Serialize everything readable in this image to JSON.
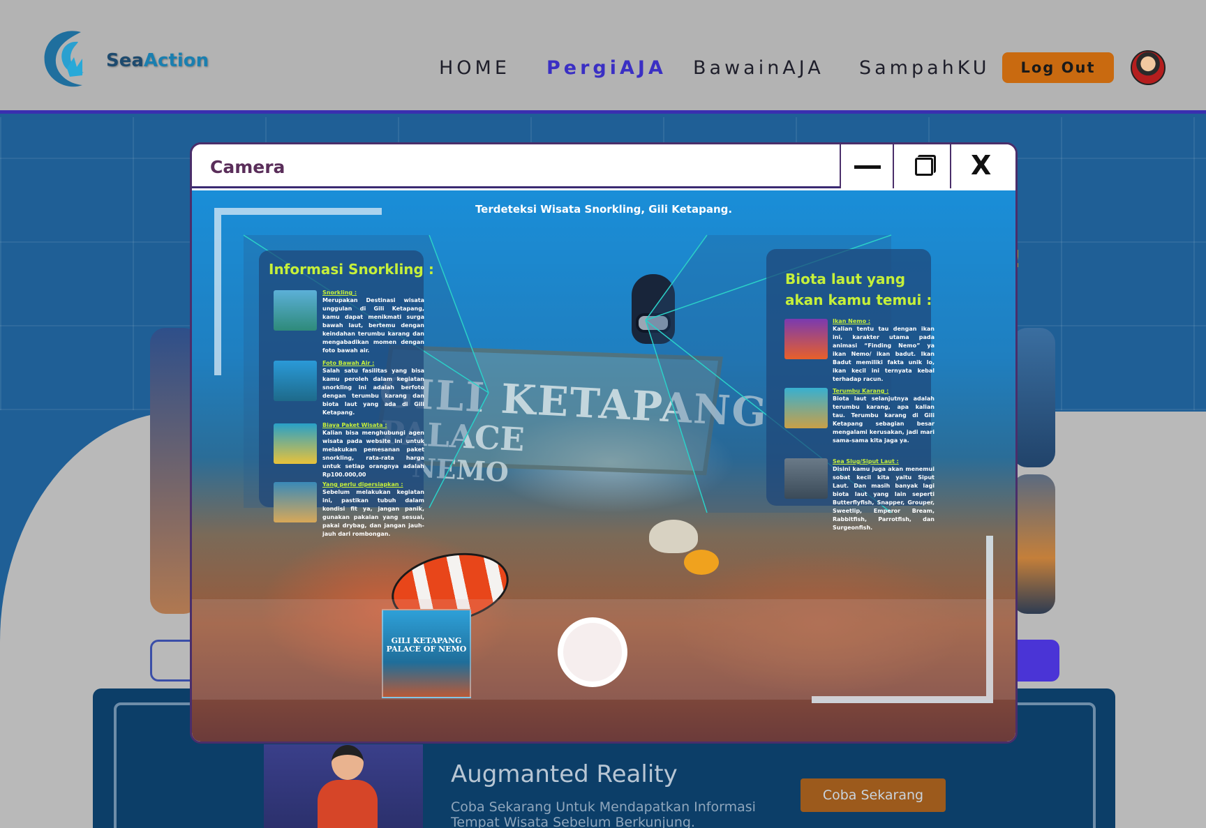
{
  "nav": {
    "brand": {
      "part1": "Sea",
      "part2": "Action"
    },
    "links": [
      "HOME",
      "PergiAJA",
      "BawainAJA",
      "SampahKU"
    ],
    "active": "PergiAJA",
    "logout_label": "Log Out",
    "accent_color": "#3a2fc4",
    "logout_color": "#c96a10"
  },
  "background": {
    "exclaim": "!",
    "ar_section": {
      "title": "Augmanted Reality",
      "description": "Coba Sekarang Untuk Mendapatkan Informasi Tempat Wisata Sebelum Berkunjung.",
      "cta": "Coba Sekarang"
    }
  },
  "camera": {
    "title": "Camera",
    "close_glyph": "X",
    "detection": "Terdeteksi Wisata Snorkling, Gili Ketapang.",
    "sign_text": [
      "GILI KETAPANG",
      "PALACE",
      "NEMO"
    ],
    "thumbnail_text": "GILI KETAPANG PALACE OF NEMO",
    "left_panel": {
      "title": "Informasi Snorkling :",
      "items": [
        {
          "heading": "Snorkling :",
          "text": "Merupakan Destinasi wisata unggulan di Gili Ketapang, kamu dapat menikmati surga bawah laut, bertemu dengan keindahan terumbu karang dan mengabadikan momen dengan foto bawah air."
        },
        {
          "heading": "Foto Bawah Air :",
          "text": "Salah satu fasilitas yang bisa kamu peroleh dalam kegiatan snorkling ini adalah berfoto dengan terumbu karang dan biota laut yang ada di Gili Ketapang."
        },
        {
          "heading": "Biaya Paket Wisata :",
          "text": "Kalian bisa menghubungi agen wisata pada website ini untuk melakukan pemesanan paket snorkling, rata-rata harga untuk setiap orangnya adalah Rp100.000,00"
        },
        {
          "heading": "Yang perlu dipersiapkan :",
          "text": "Sebelum melakukan kegiatan ini, pastikan tubuh dalam kondisi fit ya, jangan panik, gunakan pakaian yang sesuai, pakai drybag, dan jangan jauh-jauh dari rombongan."
        }
      ]
    },
    "right_panel": {
      "title": "Biota laut yang akan kamu temui :",
      "items": [
        {
          "heading": "Ikan Nemo :",
          "text": "Kalian tentu tau dengan ikan ini, karakter utama pada animasi “Finding Nemo” ya ikan Nemo/ ikan badut. Ikan Badut memiliki fakta unik lo, ikan kecil ini ternyata kebal terhadap racun."
        },
        {
          "heading": "Terumbu Karang :",
          "text": "Biota laut selanjutnya adalah terumbu karang, apa kalian tau. Terumbu karang di Gili Ketapang sebagian besar mengalami kerusakan, jadi mari sama-sama kita jaga ya."
        },
        {
          "heading": "Sea Slug/Siput Laut :",
          "text": "Disini kamu juga akan menemui sobat kecil kita yaitu Siput Laut. Dan masih banyak lagi biota laut yang lain seperti Butterflyfish, Snapper, Grouper, Sweetlip, Emperor Bream, Rabbitfish, Parrotfish, dan Surgeonfish."
        }
      ]
    },
    "panel_title_color": "#c6f03a"
  }
}
